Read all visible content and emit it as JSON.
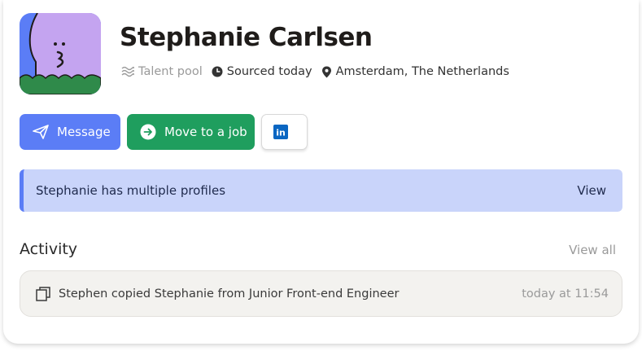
{
  "profile": {
    "name": "Stephanie Carlsen",
    "pool": "Talent pool",
    "sourced": "Sourced today",
    "location": "Amsterdam, The Netherlands"
  },
  "actions": {
    "message_label": "Message",
    "move_label": "Move to a job",
    "linkedin_label": "in"
  },
  "banner": {
    "text": "Stephanie has multiple profiles",
    "action": "View"
  },
  "activity": {
    "title": "Activity",
    "view_all": "View all",
    "items": [
      {
        "text": "Stephen copied Stephanie from Junior Front-end Engineer",
        "time": "today at 11:54"
      }
    ]
  },
  "icons": {
    "pool": "wave-icon",
    "sourced": "clock-icon",
    "location": "location-pin-icon",
    "message": "send-icon",
    "move": "arrow-circle-icon",
    "linkedin": "linkedin-icon",
    "activity": "copy-icon"
  },
  "colors": {
    "accent_blue": "#5b7df6",
    "accent_green": "#1f9e5e",
    "banner_bg": "#c9d4fa",
    "linkedin_blue": "#0a66c2"
  }
}
